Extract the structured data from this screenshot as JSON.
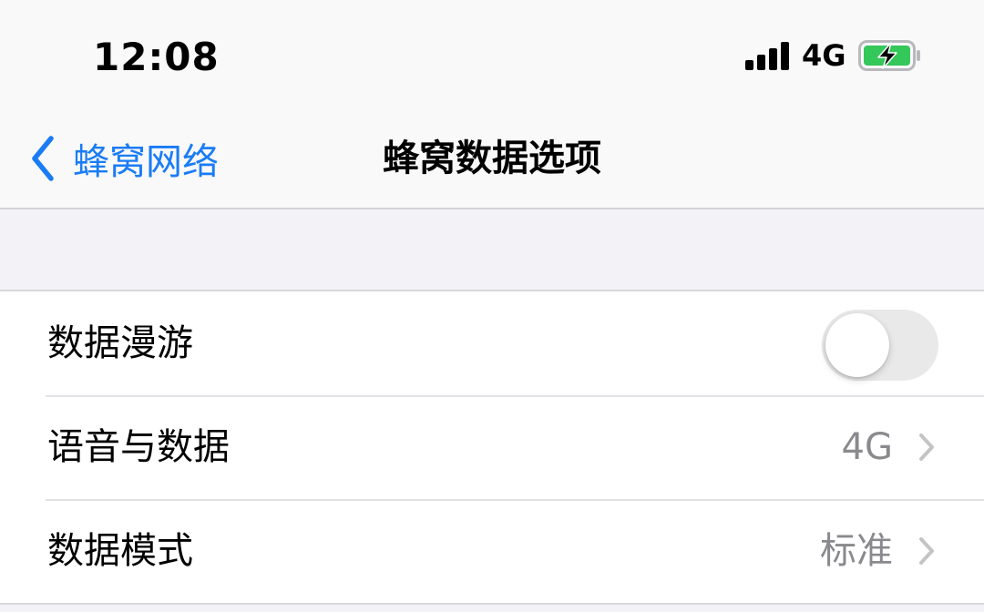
{
  "status_bar": {
    "time": "12:08",
    "network": "4G",
    "battery_state": "charging",
    "signal_bars": 4
  },
  "nav": {
    "back_label": "蜂窝网络",
    "title": "蜂窝数据选项"
  },
  "settings": {
    "data_roaming": {
      "label": "数据漫游",
      "enabled": false
    },
    "voice_and_data": {
      "label": "语音与数据",
      "value": "4G"
    },
    "data_mode": {
      "label": "数据模式",
      "value": "标准"
    }
  },
  "colors": {
    "accent": "#1a7cf5",
    "battery_fill": "#34c759",
    "secondary_text": "#8a8a8e"
  },
  "icons": [
    "cellular-signal-icon",
    "battery-charging-icon",
    "chevron-left-icon",
    "chevron-right-icon"
  ]
}
